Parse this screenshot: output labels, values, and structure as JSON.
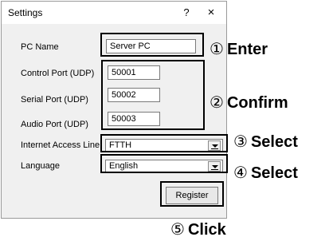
{
  "dialog": {
    "title": "Settings",
    "help_label": "?",
    "close_label": "×"
  },
  "fields": {
    "pc_name": {
      "label": "PC Name",
      "value": "Server PC"
    },
    "control_port": {
      "label": "Control Port (UDP)",
      "value": "50001"
    },
    "serial_port": {
      "label": "Serial Port (UDP)",
      "value": "50002"
    },
    "audio_port": {
      "label": "Audio Port (UDP)",
      "value": "50003"
    },
    "internet_line": {
      "label": "Internet Access Line",
      "value": "FTTH"
    },
    "language": {
      "label": "Language",
      "value": "English"
    }
  },
  "register_label": "Register",
  "annotations": {
    "a1": {
      "num": "①",
      "text": "Enter"
    },
    "a2": {
      "num": "②",
      "text": "Confirm"
    },
    "a3": {
      "num": "③",
      "text": "Select"
    },
    "a4": {
      "num": "④",
      "text": "Select"
    },
    "a5": {
      "num": "⑤",
      "text": "Click"
    }
  }
}
